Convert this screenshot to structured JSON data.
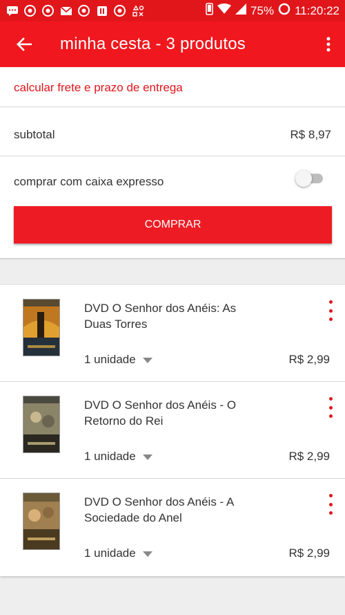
{
  "status_bar": {
    "battery_percent": "75%",
    "time": "11:20:22"
  },
  "app_bar": {
    "title": "minha cesta - 3 produtos"
  },
  "summary": {
    "shipping_link": "calcular frete e prazo de entrega",
    "subtotal_label": "subtotal",
    "subtotal_value": "R$ 8,97",
    "express_label": "comprar com caixa expresso",
    "express_enabled": false,
    "buy_button": "COMPRAR"
  },
  "products": [
    {
      "name": "DVD O Senhor dos Anéis:  As Duas Torres",
      "quantity": "1 unidade",
      "price": "R$ 2,99"
    },
    {
      "name": "DVD O Senhor dos Anéis - O Retorno do Rei",
      "quantity": "1 unidade",
      "price": "R$ 2,99"
    },
    {
      "name": "DVD O Senhor dos Anéis - A Sociedade do Anel",
      "quantity": "1 unidade",
      "price": "R$ 2,99"
    }
  ],
  "colors": {
    "primary_red": "#f0171e",
    "accent_red": "#e0161b"
  }
}
